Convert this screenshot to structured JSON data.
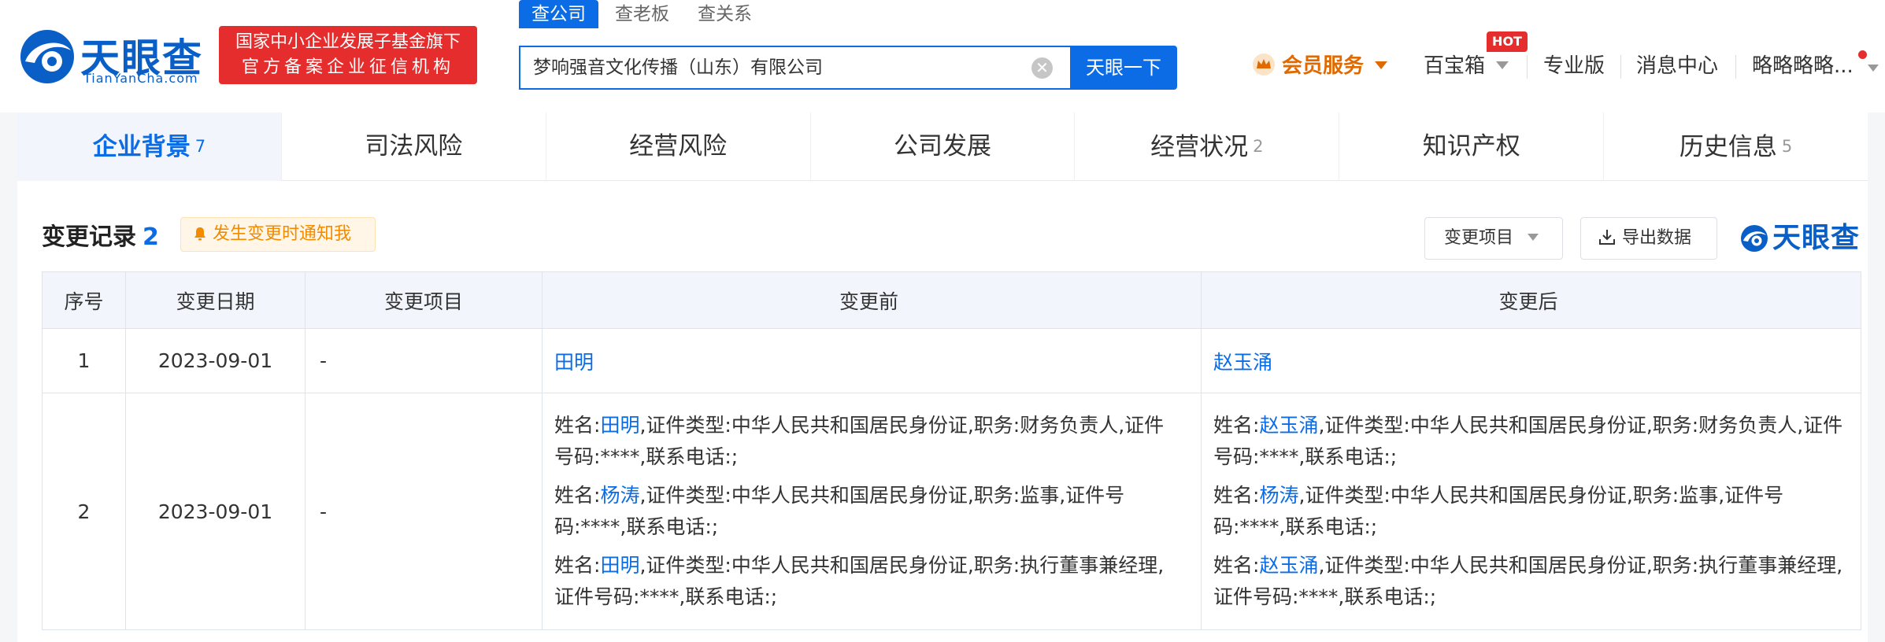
{
  "header": {
    "logo_cn": "天眼查",
    "logo_en": "TianYanCha.com",
    "badge_line1": "国家中小企业发展子基金旗下",
    "badge_line2": "官方备案企业征信机构",
    "search_tabs": [
      "查公司",
      "查老板",
      "查关系"
    ],
    "search_value": "梦响强音文化传播（山东）有限公司",
    "clear_glyph": "✕",
    "search_button": "天眼一下",
    "vip_label": "会员服务",
    "treasure_label": "百宝箱",
    "hot_badge": "HOT",
    "pro_label": "专业版",
    "msg_label": "消息中心",
    "user_label": "略略略略..."
  },
  "tabs": [
    {
      "label": "企业背景",
      "count": "7"
    },
    {
      "label": "司法风险",
      "count": ""
    },
    {
      "label": "经营风险",
      "count": ""
    },
    {
      "label": "公司发展",
      "count": ""
    },
    {
      "label": "经营状况",
      "count": "2"
    },
    {
      "label": "知识产权",
      "count": ""
    },
    {
      "label": "历史信息",
      "count": "5"
    }
  ],
  "section": {
    "title": "变更记录",
    "count": "2",
    "notify_label": "发生变更时通知我",
    "filter_label": "变更项目",
    "export_label": "导出数据",
    "watermark": "天眼查"
  },
  "table": {
    "headers": [
      "序号",
      "变更日期",
      "变更项目",
      "变更前",
      "变更后"
    ],
    "row1": {
      "idx": "1",
      "date": "2023-09-01",
      "item": "-",
      "before": "田明",
      "after": "赵玉涌"
    },
    "row2": {
      "idx": "2",
      "date": "2023-09-01",
      "item": "-",
      "label_name": "姓名:",
      "before": [
        {
          "name": "田明",
          "rest": ",证件类型:中华人民共和国居民身份证,职务:财务负责人,证件号码:****,联系电话:;"
        },
        {
          "name": "杨涛",
          "rest": ",证件类型:中华人民共和国居民身份证,职务:监事,证件号码:****,联系电话:;"
        },
        {
          "name": "田明",
          "rest": ",证件类型:中华人民共和国居民身份证,职务:执行董事兼经理,证件号码:****,联系电话:;"
        }
      ],
      "after": [
        {
          "name": "赵玉涌",
          "rest": ",证件类型:中华人民共和国居民身份证,职务:财务负责人,证件号码:****,联系电话:;"
        },
        {
          "name": "杨涛",
          "rest": ",证件类型:中华人民共和国居民身份证,职务:监事,证件号码:****,联系电话:;"
        },
        {
          "name": "赵玉涌",
          "rest": ",证件类型:中华人民共和国居民身份证,职务:执行董事兼经理,证件号码:****,联系电话:;"
        }
      ]
    }
  },
  "colors": {
    "brand_blue": "#0b6ce6",
    "badge_red": "#e52d2d",
    "vip_orange": "#e06a00",
    "notify_orange": "#f28b00"
  }
}
